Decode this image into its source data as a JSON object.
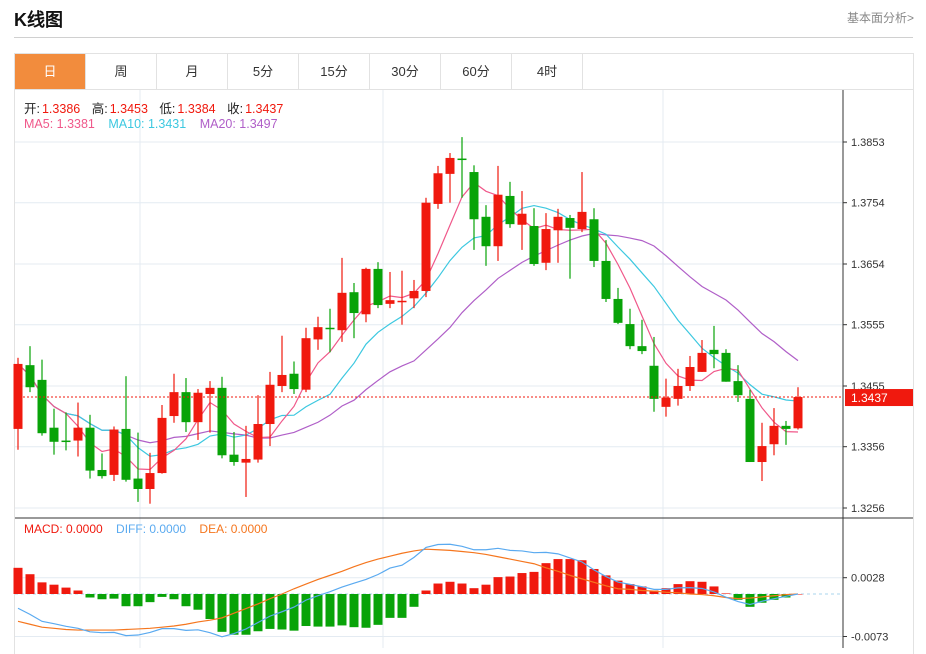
{
  "header": {
    "title": "K线图",
    "link": "基本面分析>"
  },
  "tabs": [
    {
      "label": "日",
      "active": true
    },
    {
      "label": "周"
    },
    {
      "label": "月"
    },
    {
      "label": "5分"
    },
    {
      "label": "15分"
    },
    {
      "label": "30分"
    },
    {
      "label": "60分"
    },
    {
      "label": "4时"
    }
  ],
  "legend": {
    "open_label": "开:",
    "open": "1.3386",
    "high_label": "高:",
    "high": "1.3453",
    "low_label": "低:",
    "low": "1.3384",
    "close_label": "收:",
    "close": "1.3437",
    "ma5": "MA5: 1.3381",
    "ma10": "MA10: 1.3431",
    "ma20": "MA20: 1.3497"
  },
  "macd_legend": {
    "macd": "MACD: 0.0000",
    "diff": "DIFF: 0.0000",
    "dea": "DEA: 0.0000"
  },
  "colors": {
    "up": "#f0190e",
    "down": "#08a308",
    "ma5": "#f0588a",
    "ma10": "#3cc8e0",
    "ma20": "#b05fc8",
    "diff": "#5aaaf0",
    "dea": "#f5761e",
    "accent": "#f28c3d"
  },
  "chart_data": {
    "type": "candlestick",
    "price_ticks": [
      "1.3853",
      "1.3754",
      "1.3654",
      "1.3555",
      "1.3455",
      "1.3356",
      "1.3256"
    ],
    "price_range": [
      1.3256,
      1.3853
    ],
    "current_price": "1.3437",
    "ohlc": [
      [
        1.3385,
        1.3501,
        1.3351,
        1.3491
      ],
      [
        1.3489,
        1.352,
        1.3445,
        1.3453
      ],
      [
        1.3465,
        1.3498,
        1.3374,
        1.3378
      ],
      [
        1.3387,
        1.3418,
        1.3343,
        1.3364
      ],
      [
        1.3366,
        1.3412,
        1.335,
        1.3365
      ],
      [
        1.3366,
        1.3428,
        1.334,
        1.3387
      ],
      [
        1.3387,
        1.3408,
        1.3304,
        1.3317
      ],
      [
        1.3318,
        1.3345,
        1.3304,
        1.3308
      ],
      [
        1.331,
        1.3389,
        1.33,
        1.3384
      ],
      [
        1.3385,
        1.3471,
        1.3299,
        1.3302
      ],
      [
        1.3304,
        1.3379,
        1.3266,
        1.3287
      ],
      [
        1.3287,
        1.3346,
        1.3263,
        1.3313
      ],
      [
        1.3313,
        1.3424,
        1.3312,
        1.3403
      ],
      [
        1.3406,
        1.3475,
        1.3395,
        1.3445
      ],
      [
        1.3445,
        1.3468,
        1.338,
        1.3396
      ],
      [
        1.3396,
        1.345,
        1.3367,
        1.3444
      ],
      [
        1.3442,
        1.3463,
        1.3379,
        1.3452
      ],
      [
        1.3452,
        1.347,
        1.3337,
        1.3342
      ],
      [
        1.3343,
        1.338,
        1.3325,
        1.3331
      ],
      [
        1.333,
        1.339,
        1.3274,
        1.3336
      ],
      [
        1.3335,
        1.344,
        1.333,
        1.3393
      ],
      [
        1.3393,
        1.3478,
        1.3357,
        1.3457
      ],
      [
        1.3455,
        1.3537,
        1.3445,
        1.3473
      ],
      [
        1.3475,
        1.3495,
        1.3442,
        1.345
      ],
      [
        1.3449,
        1.355,
        1.3445,
        1.3533
      ],
      [
        1.3531,
        1.3568,
        1.3514,
        1.3551
      ],
      [
        1.355,
        1.3581,
        1.351,
        1.3548
      ],
      [
        1.3546,
        1.3664,
        1.3527,
        1.3607
      ],
      [
        1.3608,
        1.3623,
        1.3533,
        1.3574
      ],
      [
        1.3572,
        1.3648,
        1.3559,
        1.3646
      ],
      [
        1.3646,
        1.3657,
        1.3582,
        1.3587
      ],
      [
        1.3589,
        1.3641,
        1.3582,
        1.3595
      ],
      [
        1.3593,
        1.3643,
        1.3555,
        1.3594
      ],
      [
        1.3598,
        1.3628,
        1.3582,
        1.361
      ],
      [
        1.361,
        1.3762,
        1.36,
        1.3754
      ],
      [
        1.3752,
        1.3814,
        1.3744,
        1.3802
      ],
      [
        1.3801,
        1.3835,
        1.3754,
        1.3827
      ],
      [
        1.3826,
        1.3861,
        1.3762,
        1.3824
      ],
      [
        1.3804,
        1.3815,
        1.3677,
        1.3727
      ],
      [
        1.3731,
        1.375,
        1.3651,
        1.3683
      ],
      [
        1.3683,
        1.3814,
        1.3659,
        1.3767
      ],
      [
        1.3765,
        1.3788,
        1.3713,
        1.3719
      ],
      [
        1.3718,
        1.3773,
        1.3677,
        1.3736
      ],
      [
        1.3716,
        1.3745,
        1.3651,
        1.3654
      ],
      [
        1.3656,
        1.3737,
        1.3644,
        1.3711
      ],
      [
        1.3709,
        1.3744,
        1.3656,
        1.3731
      ],
      [
        1.3729,
        1.3734,
        1.363,
        1.3713
      ],
      [
        1.3711,
        1.3804,
        1.3706,
        1.3739
      ],
      [
        1.3727,
        1.3745,
        1.3649,
        1.3659
      ],
      [
        1.3659,
        1.3693,
        1.3592,
        1.3597
      ],
      [
        1.3597,
        1.3615,
        1.3556,
        1.3558
      ],
      [
        1.3556,
        1.3581,
        1.3515,
        1.352
      ],
      [
        1.352,
        1.3563,
        1.3507,
        1.3512
      ],
      [
        1.3488,
        1.3535,
        1.3413,
        1.3434
      ],
      [
        1.3421,
        1.3467,
        1.3405,
        1.3436
      ],
      [
        1.3434,
        1.3483,
        1.3423,
        1.3455
      ],
      [
        1.3455,
        1.3504,
        1.3447,
        1.3486
      ],
      [
        1.3478,
        1.353,
        1.3478,
        1.3509
      ],
      [
        1.3514,
        1.3553,
        1.3484,
        1.3507
      ],
      [
        1.3509,
        1.3515,
        1.3462,
        1.3462
      ],
      [
        1.3463,
        1.3489,
        1.3429,
        1.344
      ],
      [
        1.3434,
        1.3449,
        1.3331,
        1.3331
      ],
      [
        1.3331,
        1.3395,
        1.33,
        1.3357
      ],
      [
        1.336,
        1.3419,
        1.3342,
        1.339
      ],
      [
        1.339,
        1.3398,
        1.3359,
        1.3385
      ],
      [
        1.3386,
        1.3453,
        1.3384,
        1.3437
      ]
    ],
    "macd_ticks": [
      "0.0028",
      "-0.0073"
    ],
    "macd_hist": [
      0.0045,
      0.0034,
      0.002,
      0.0016,
      0.0011,
      0.0006,
      -0.0006,
      -0.0009,
      -0.0008,
      -0.0021,
      -0.0021,
      -0.0014,
      -0.0005,
      -0.0009,
      -0.0021,
      -0.0027,
      -0.0043,
      -0.0065,
      -0.007,
      -0.007,
      -0.0064,
      -0.006,
      -0.0061,
      -0.0063,
      -0.0055,
      -0.0056,
      -0.0056,
      -0.0054,
      -0.0057,
      -0.0058,
      -0.0053,
      -0.0041,
      -0.0041,
      -0.0022,
      0.0006,
      0.0018,
      0.0021,
      0.0018,
      0.001,
      0.0016,
      0.0029,
      0.003,
      0.0036,
      0.0038,
      0.0053,
      0.006,
      0.006,
      0.0058,
      0.0043,
      0.0032,
      0.0023,
      0.0017,
      0.0013,
      0.0006,
      0.001,
      0.0017,
      0.0022,
      0.0021,
      0.0013,
      0.0001,
      -0.001,
      -0.0022,
      -0.0015,
      -0.001,
      -0.0006,
      0.0
    ],
    "dea": [
      -0.0047,
      -0.0052,
      -0.0057,
      -0.0059,
      -0.0061,
      -0.0062,
      -0.0062,
      -0.0062,
      -0.0062,
      -0.0061,
      -0.006,
      -0.0059,
      -0.0057,
      -0.0055,
      -0.0052,
      -0.0048,
      -0.0045,
      -0.0041,
      -0.0033,
      -0.0025,
      -0.0017,
      -0.0008,
      0.0,
      0.0009,
      0.0017,
      0.0025,
      0.0032,
      0.0039,
      0.0047,
      0.0054,
      0.006,
      0.0065,
      0.007,
      0.0074,
      0.0077,
      0.0076,
      0.0075,
      0.0073,
      0.0071,
      0.0068,
      0.0064,
      0.006,
      0.0056,
      0.0052,
      0.0045,
      0.0039,
      0.0032,
      0.0026,
      0.002,
      0.0014,
      0.0009,
      0.0008,
      0.0006,
      0.0005,
      0.0003,
      0.0002,
      0.0,
      -0.0001,
      -0.0003,
      -0.0006,
      -0.0008,
      -0.0007,
      -0.0005,
      -0.0003,
      -0.0001,
      0.0
    ]
  }
}
